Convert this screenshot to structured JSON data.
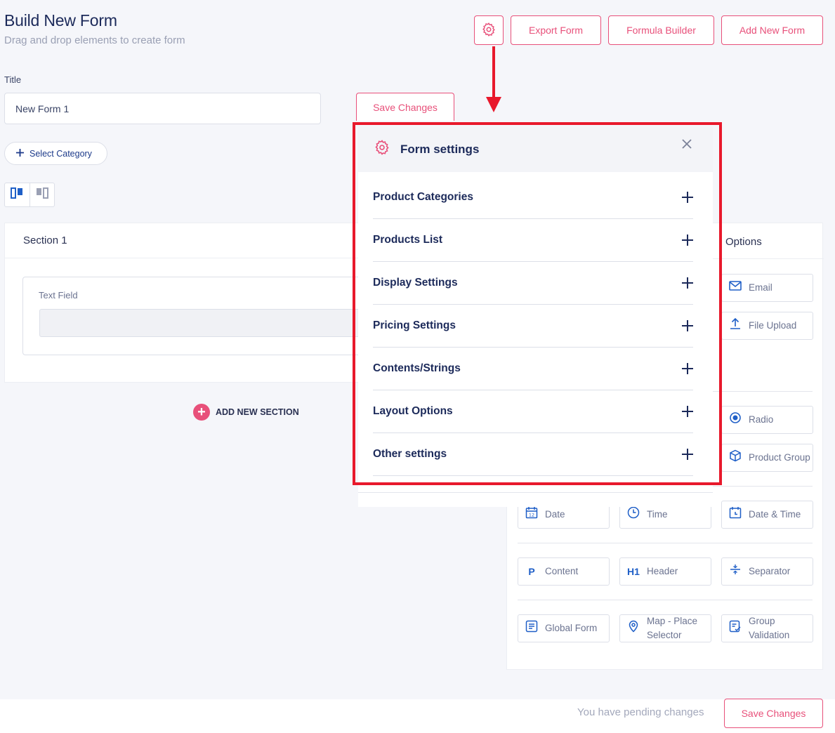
{
  "header": {
    "title": "Build New Form",
    "subtitle": "Drag and drop elements to create form",
    "export_label": "Export Form",
    "formula_label": "Formula Builder",
    "add_form_label": "Add New Form"
  },
  "form": {
    "title_label": "Title",
    "title_value": "New Form 1",
    "save_label": "Save Changes",
    "category_label": "Select Category"
  },
  "section": {
    "name": "Section 1",
    "field_label": "Text Field",
    "add_section_label": "ADD NEW SECTION"
  },
  "panel": {
    "options_label": "Options",
    "tools": [
      {
        "label": "Email",
        "icon": "mail-icon"
      },
      {
        "label": "File Upload",
        "icon": "upload-icon"
      },
      {
        "label": "Radio",
        "icon": "radio-icon"
      },
      {
        "label": "Product Group",
        "icon": "box-icon"
      },
      {
        "label": "Date",
        "icon": "calendar-icon"
      },
      {
        "label": "Time",
        "icon": "clock-icon"
      },
      {
        "label": "Date & Time",
        "icon": "calendar-time-icon"
      },
      {
        "label": "Content",
        "icon": "paragraph-icon"
      },
      {
        "label": "Header",
        "icon": "heading-icon"
      },
      {
        "label": "Separator",
        "icon": "separator-icon"
      },
      {
        "label": "Global Form",
        "icon": "form-icon"
      },
      {
        "label": "Map - Place Selector",
        "icon": "map-pin-icon"
      },
      {
        "label": "Group Validation",
        "icon": "checklist-icon"
      }
    ]
  },
  "modal": {
    "title": "Form settings",
    "sections": [
      "Product Categories",
      "Products List",
      "Display Settings",
      "Pricing Settings",
      "Contents/Strings",
      "Layout Options",
      "Other settings"
    ]
  },
  "footer": {
    "pending_text": "You have pending changes",
    "save_label": "Save Changes"
  },
  "colors": {
    "accent": "#e8507a",
    "primary_text": "#1c2a5a",
    "highlight_frame": "#e8192c",
    "icon_blue": "#1f5fc7"
  }
}
